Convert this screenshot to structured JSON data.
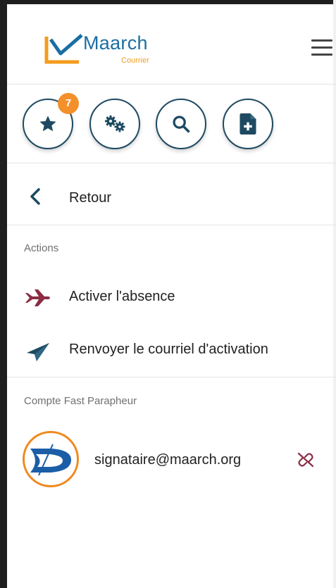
{
  "header": {
    "logo_name": "Maarch",
    "logo_sub": "Courrier"
  },
  "quick_actions": {
    "favorites_badge": "7"
  },
  "nav": {
    "back_label": "Retour"
  },
  "actions_section": {
    "title": "Actions",
    "items": [
      {
        "label": "Activer l'absence",
        "icon": "plane-icon"
      },
      {
        "label": "Renvoyer le courriel d'activation",
        "icon": "paper-plane-icon"
      }
    ]
  },
  "account_section": {
    "title": "Compte Fast Parapheur",
    "email": "signataire@maarch.org"
  },
  "colors": {
    "brand_blue": "#1a6ea3",
    "brand_orange": "#f39c1d",
    "dark_teal": "#1d4a62",
    "absence_red": "#8a2d44",
    "badge_orange": "#f3902a"
  }
}
